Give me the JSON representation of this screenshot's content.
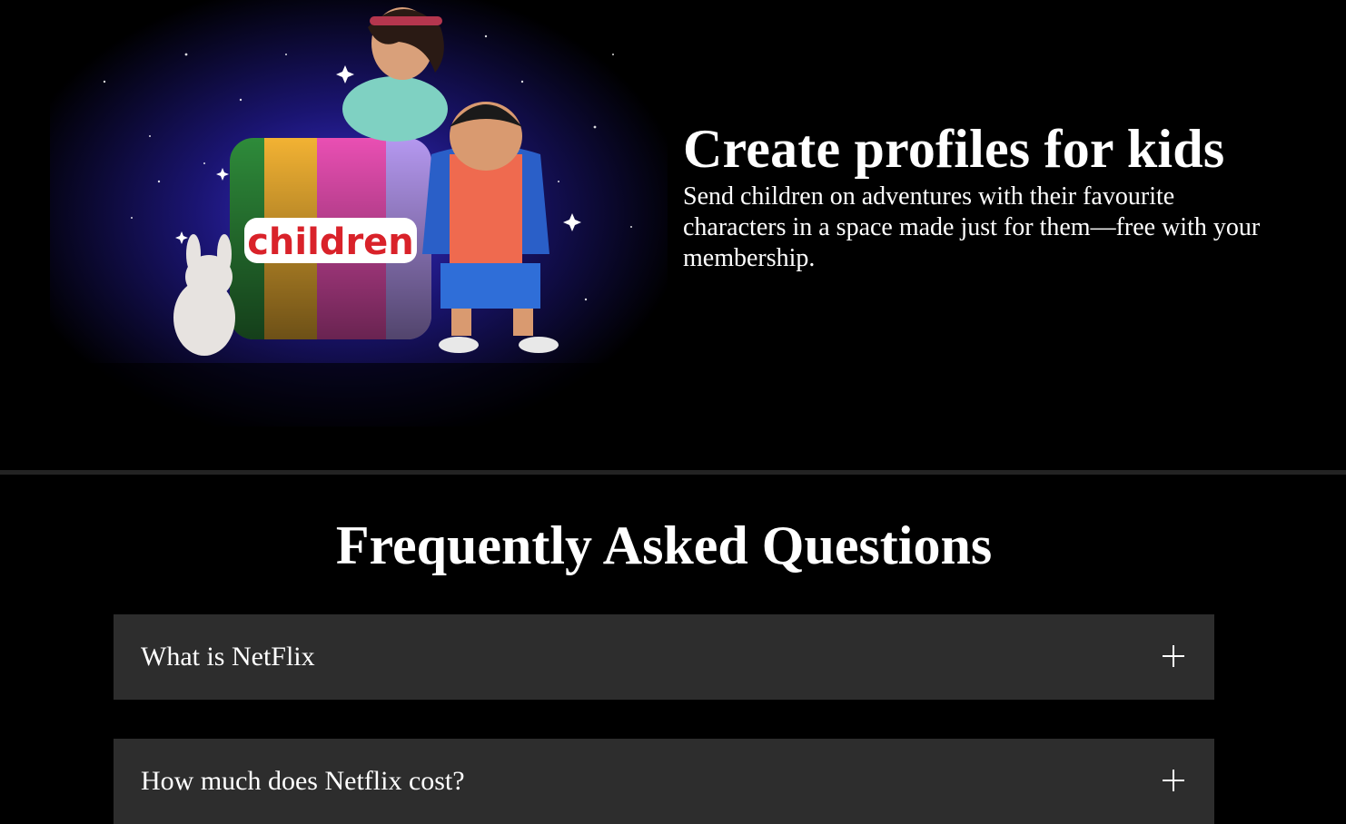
{
  "kids": {
    "title": "Create profiles for kids",
    "description": "Send children on adventures with their favourite characters in a space made just for them—free with your membership.",
    "tile_label": "children"
  },
  "faq": {
    "title": "Frequently Asked Questions",
    "items": [
      {
        "question": "What is NetFlix"
      },
      {
        "question": "How much does Netflix cost?"
      }
    ]
  },
  "colors": {
    "background": "#000000",
    "divider": "#232323",
    "faq_item_bg": "#2d2d2d",
    "text": "#ffffff"
  }
}
